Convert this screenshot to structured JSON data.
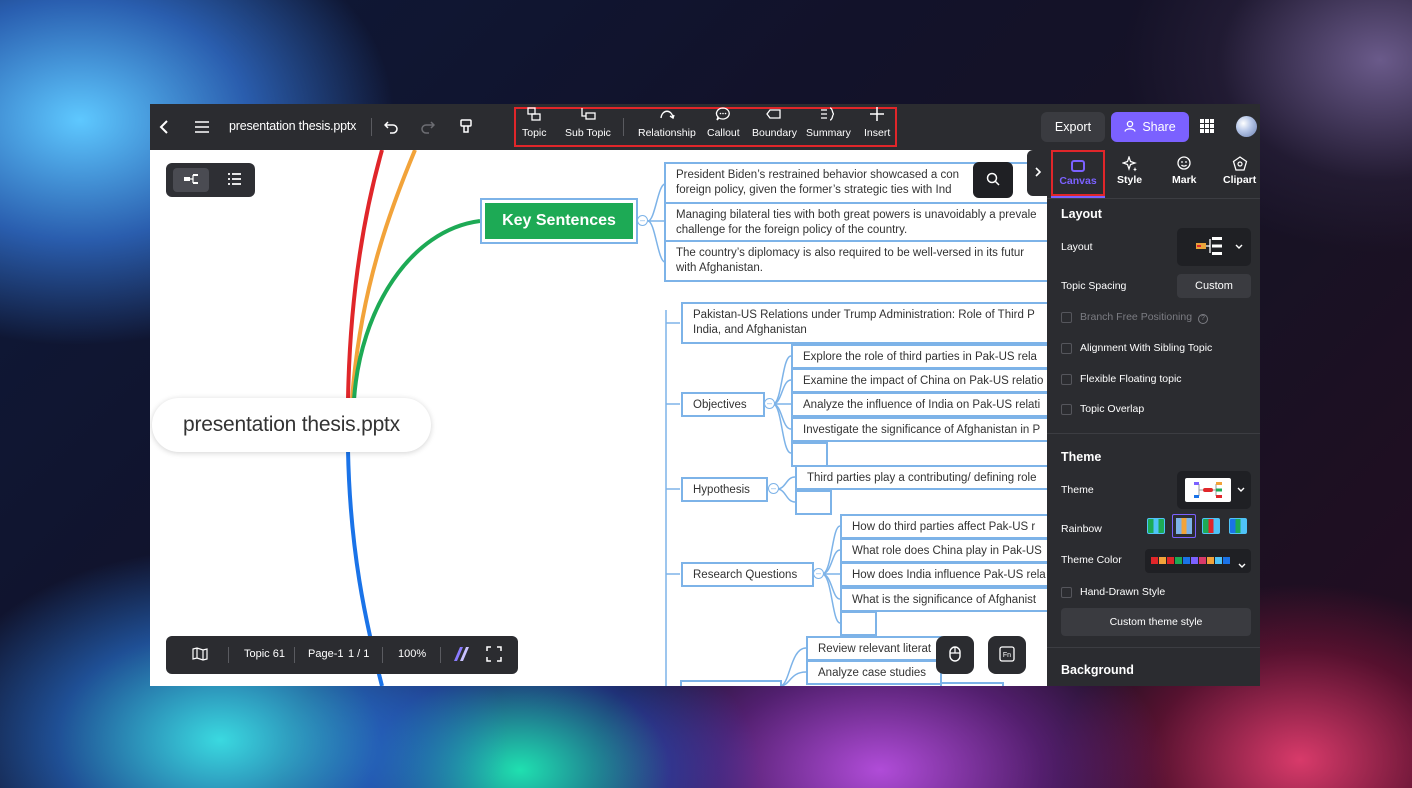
{
  "topbar": {
    "file_name": "presentation thesis.pptx",
    "tools": [
      {
        "icon": "topic-icon",
        "label": "Topic"
      },
      {
        "icon": "sub-topic-icon",
        "label": "Sub Topic"
      },
      {
        "icon": "relationship-icon",
        "label": "Relationship"
      },
      {
        "icon": "callout-icon",
        "label": "Callout"
      },
      {
        "icon": "boundary-icon",
        "label": "Boundary"
      },
      {
        "icon": "summary-icon",
        "label": "Summary"
      },
      {
        "icon": "plus-icon",
        "label": "Insert"
      }
    ],
    "export_label": "Export",
    "share_label": "Share"
  },
  "mindmap": {
    "central": "presentation thesis.pptx",
    "key_sentences": "Key Sentences",
    "key_items": [
      {
        "l1": "President Biden’s restrained behavior showcased a con",
        "l2": "foreign policy, given the former’s strategic ties with Ind"
      },
      {
        "l1": "Managing bilateral ties with both great powers is unavoidably a prevale",
        "l2": "challenge for the foreign policy of the country."
      },
      {
        "l1": "The country’s diplomacy is also required to be well-versed in its futur",
        "l2": "with Afghanistan."
      }
    ],
    "title_topic": {
      "l1": "Pakistan-US Relations under Trump Administration: Role of Third P",
      "l2": "India, and Afghanistan"
    },
    "objectives": "Objectives",
    "objective_items": [
      "Explore the role of third parties in Pak-US rela",
      "Examine the impact of China on Pak-US relatio",
      "Analyze the influence of India on Pak-US relati",
      "Investigate the significance of Afghanistan in P"
    ],
    "hypothesis": "Hypothesis",
    "hypothesis_item": "Third parties play a contributing/ defining role",
    "research_questions": "Research Questions",
    "rq_items": [
      "How do third parties affect Pak-US r",
      "What role does China play in Pak-US",
      "How does India influence Pak-US rela",
      "What is the significance of Afghanist"
    ],
    "method_items": [
      "Review relevant literat",
      "Analyze case studies"
    ]
  },
  "bottombar": {
    "topic_count": "Topic 61",
    "page": "Page-1",
    "page_of": "1 / 1",
    "zoom": "100%"
  },
  "panel": {
    "tabs": {
      "canvas": "Canvas",
      "style": "Style",
      "mark": "Mark",
      "clipart": "Clipart"
    },
    "layout_title": "Layout",
    "layout_label": "Layout",
    "topic_spacing_label": "Topic Spacing",
    "topic_spacing_value": "Custom",
    "checks": {
      "branch_free": "Branch Free Positioning",
      "alignment": "Alignment With Sibling Topic",
      "flexible": "Flexible Floating topic",
      "overlap": "Topic Overlap"
    },
    "theme_title": "Theme",
    "theme_label": "Theme",
    "rainbow_label": "Rainbow",
    "theme_color_label": "Theme Color",
    "hand_drawn": "Hand-Drawn Style",
    "custom_theme": "Custom theme style",
    "background_title": "Background"
  },
  "colors": {
    "accent": "#7b61ff",
    "highlight_border": "#e0262a",
    "key_node": "#1daa55",
    "node_border": "#7db3e8"
  }
}
